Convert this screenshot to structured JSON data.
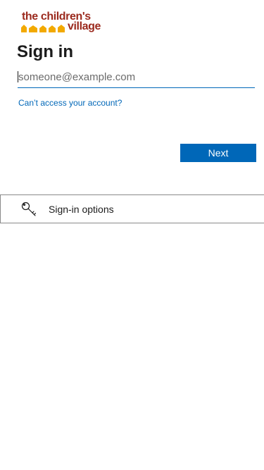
{
  "logo": {
    "line1": "the children's",
    "line2": "village",
    "brand_color": "#9b2a1e",
    "accent_color": "#f2a900"
  },
  "signin": {
    "title": "Sign in",
    "email_value": "",
    "email_placeholder": "someone@example.com",
    "cant_access_link": "Can’t access your account?",
    "next_label": "Next"
  },
  "options": {
    "label": "Sign-in options",
    "icon": "key-icon"
  },
  "colors": {
    "primary": "#0067b8",
    "text": "#1b1b1b"
  }
}
